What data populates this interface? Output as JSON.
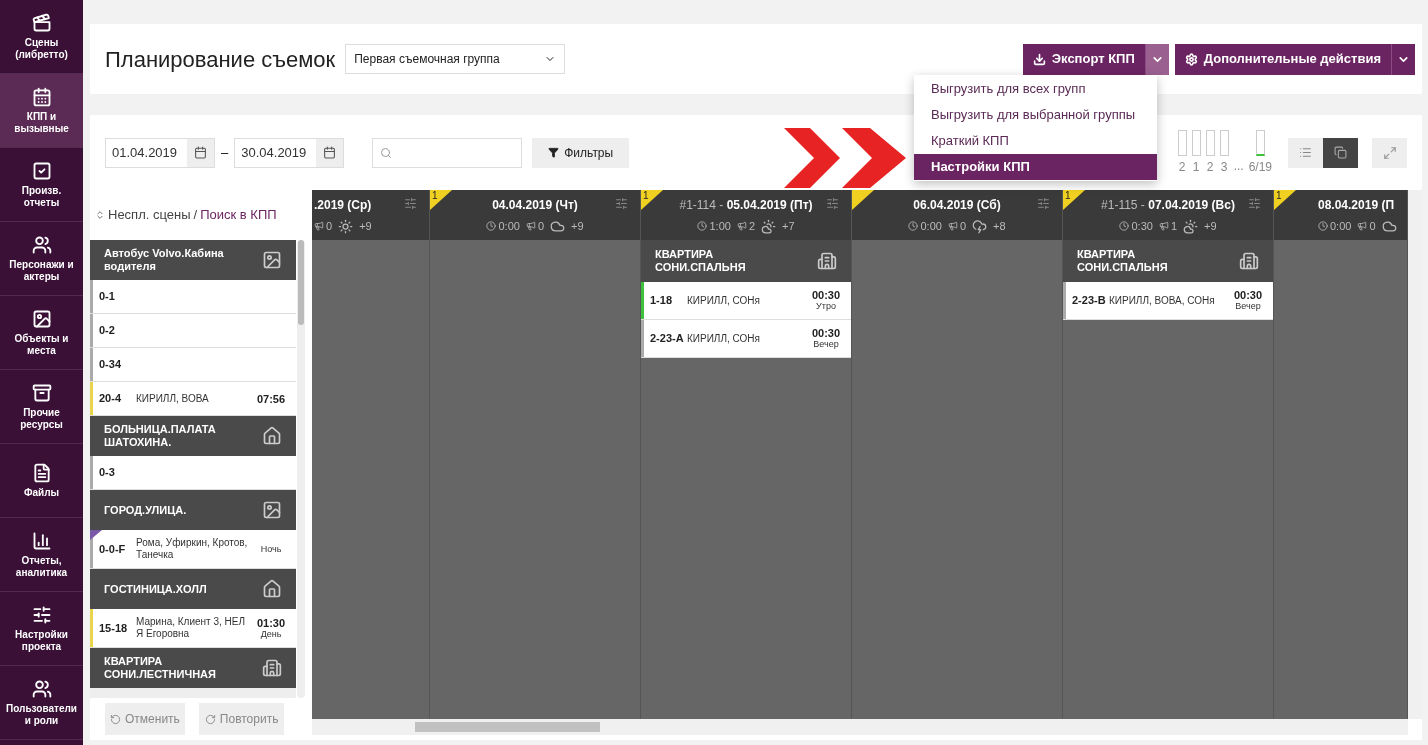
{
  "sidebar": {
    "items": [
      {
        "label": "Сцены (либретто)",
        "selected": false
      },
      {
        "label": "КПП и вызывные",
        "selected": true
      },
      {
        "label": "Произв. отчеты",
        "selected": false
      },
      {
        "label": "Персонажи и актеры",
        "selected": false
      },
      {
        "label": "Объекты и места",
        "selected": false
      },
      {
        "label": "Прочие ресурсы",
        "selected": false
      },
      {
        "label": "Файлы",
        "selected": false
      },
      {
        "label": "Отчеты, аналитика",
        "selected": false
      },
      {
        "label": "Настройки проекта",
        "selected": false
      },
      {
        "label": "Пользователи и роли",
        "selected": false
      }
    ]
  },
  "header": {
    "title": "Планирование съемок",
    "group_select": {
      "value": "Первая съемочная группа"
    },
    "export_button": {
      "label": "Экспорт КПП",
      "expanded": true
    },
    "actions_button": {
      "label": "Дополнительные действия"
    }
  },
  "export_menu": {
    "items": [
      {
        "label": "Выгрузить для всех групп",
        "selected": false
      },
      {
        "label": "Выгрузить для выбранной группы",
        "selected": false
      },
      {
        "label": "Краткий КПП",
        "selected": false
      },
      {
        "label": "Настройки КПП",
        "selected": true
      }
    ]
  },
  "toolbar": {
    "date_from": "01.04.2019",
    "date_separator": "–",
    "date_to": "30.04.2019",
    "filters_button": "Фильтры",
    "counters": [
      {
        "label": "2",
        "marked": false
      },
      {
        "label": "1",
        "marked": false
      },
      {
        "label": "2",
        "marked": false
      },
      {
        "label": "3",
        "marked": false
      },
      {
        "label": "6/19",
        "marked": true
      }
    ],
    "counters_gap": "...",
    "views": [
      {
        "selected": false
      },
      {
        "selected": true
      }
    ]
  },
  "unscheduled": {
    "title": "Неспл. сцены",
    "separator": "/",
    "link": "Поиск в КПП",
    "groups": [
      {
        "location": "Автобус Volvo.Кабина водителя",
        "scenes": [
          {
            "number": "0-1",
            "color": "#aaaaaa",
            "flagged": false
          },
          {
            "number": "0-2",
            "color": "#aaaaaa",
            "flagged": false
          },
          {
            "number": "0-34",
            "color": "#aaaaaa",
            "flagged": false
          },
          {
            "number": "20-4",
            "cast": "КИРИЛЛ, ВОВА",
            "time": "07:56",
            "color": "#e8d44d",
            "flagged": false
          }
        ]
      },
      {
        "location": "БОЛЬНИЦА.ПАЛАТА ШАТОХИНА.",
        "scenes": [
          {
            "number": "0-3",
            "color": "#aaaaaa",
            "flagged": false
          }
        ]
      },
      {
        "location": "ГОРОД.УЛИЦА.",
        "scenes": [
          {
            "number": "0-0-F",
            "cast": "Рома, Уфиркин, Кротов, Танечка",
            "part": "Ночь",
            "color": "#aaaaaa",
            "flagged": true
          }
        ]
      },
      {
        "location": "ГОСТИНИЦА.ХОЛЛ",
        "scenes": [
          {
            "number": "15-18",
            "cast": "Марина, Клиент 3, НЕЛЯ Егоровна",
            "time": "01:30",
            "part": "День",
            "color": "#e8d44d",
            "flagged": false
          }
        ]
      },
      {
        "location": "КВАРТИРА СОНИ.ЛЕСТНИЧНАЯ"
      }
    ],
    "undo": "Отменить",
    "redo": "Повторить"
  },
  "schedule": {
    "days": [
      {
        "date": ".2019 (Ср)",
        "flagged": false,
        "calls": "0",
        "extra": "+9"
      },
      {
        "date": "04.04.2019 (Чт)",
        "flag": "1",
        "flagged": true,
        "time": "0:00",
        "calls": "0",
        "extra": "+9"
      },
      {
        "code": "#1-114 - ",
        "date": "05.04.2019 (Пт)",
        "flag": "1",
        "flagged": true,
        "time": "1:00",
        "calls": "2",
        "extra": "+7",
        "blocks": [
          {
            "location": "КВАРТИРА СОНИ.СПАЛЬНЯ",
            "scenes": [
              {
                "number": "1-18",
                "cast": "КИРИЛЛ, СОНя",
                "time": "00:30",
                "part": "Утро",
                "color": "#3ec23e"
              },
              {
                "number": "2-23-А",
                "cast": "КИРИЛЛ, СОНя",
                "time": "00:30",
                "part": "Вечер",
                "color": "#aaaaaa"
              }
            ]
          }
        ]
      },
      {
        "date": "06.04.2019 (Сб)",
        "flagged": true,
        "time": "0:00",
        "calls": "0",
        "extra": "+8"
      },
      {
        "code": "#1-115 - ",
        "date": "07.04.2019 (Вс)",
        "flag": "1",
        "flagged": true,
        "time": "0:30",
        "calls": "1",
        "extra": "+9",
        "blocks": [
          {
            "location": "КВАРТИРА СОНИ.СПАЛЬНЯ",
            "scenes": [
              {
                "number": "2-23-В",
                "cast": "КИРИЛЛ, ВОВА, СОНя",
                "time": "00:30",
                "part": "Вечер",
                "color": "#aaaaaa"
              }
            ]
          }
        ]
      },
      {
        "date": "08.04.2019 (П",
        "flag": "1",
        "flagged": true,
        "time": "0:00",
        "calls": "0"
      }
    ]
  }
}
